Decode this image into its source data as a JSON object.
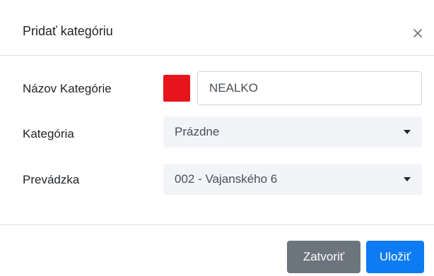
{
  "header": {
    "title": "Pridať kategóriu",
    "close_icon": "close-icon"
  },
  "form": {
    "name_label": "Názov Kategórie",
    "name_value": "NEALKO",
    "swatch_color": "#e8141d",
    "category_label": "Kategória",
    "category_value": "Prázdne",
    "shop_label": "Prevádzka",
    "shop_value": "002 - Vajanského 6"
  },
  "footer": {
    "close_label": "Zatvoriť",
    "save_label": "Uložiť"
  },
  "colors": {
    "primary": "#0d7cf2",
    "secondary": "#6c757d"
  }
}
